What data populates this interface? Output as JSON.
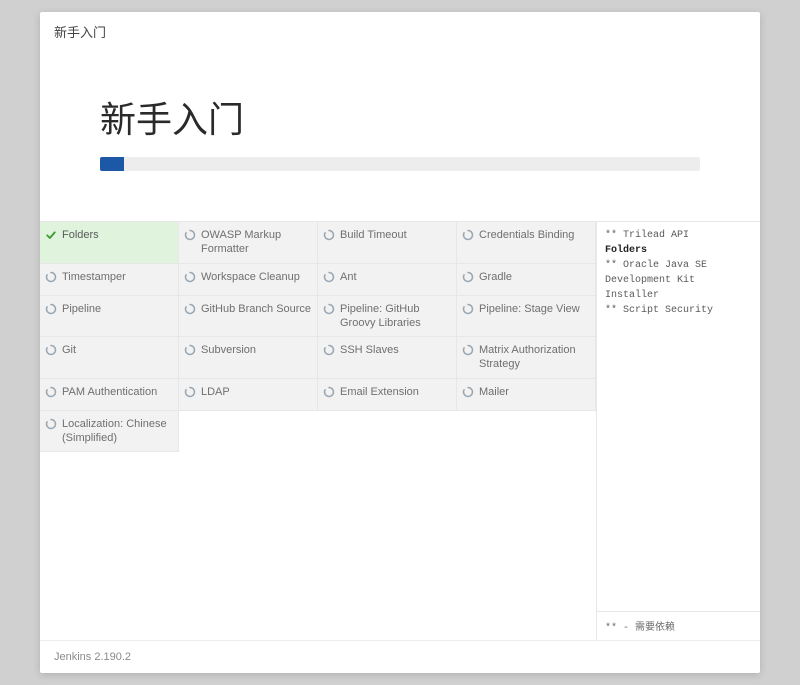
{
  "header": {
    "title": "新手入门"
  },
  "hero": {
    "title": "新手入门",
    "progress_percent": 4
  },
  "plugins": [
    {
      "name": "Folders",
      "state": "success"
    },
    {
      "name": "OWASP Markup Formatter",
      "state": "pending"
    },
    {
      "name": "Build Timeout",
      "state": "pending"
    },
    {
      "name": "Credentials Binding",
      "state": "pending"
    },
    {
      "name": "Timestamper",
      "state": "pending"
    },
    {
      "name": "Workspace Cleanup",
      "state": "pending"
    },
    {
      "name": "Ant",
      "state": "pending"
    },
    {
      "name": "Gradle",
      "state": "pending"
    },
    {
      "name": "Pipeline",
      "state": "pending"
    },
    {
      "name": "GitHub Branch Source",
      "state": "pending"
    },
    {
      "name": "Pipeline: GitHub Groovy Libraries",
      "state": "pending"
    },
    {
      "name": "Pipeline: Stage View",
      "state": "pending"
    },
    {
      "name": "Git",
      "state": "pending"
    },
    {
      "name": "Subversion",
      "state": "pending"
    },
    {
      "name": "SSH Slaves",
      "state": "pending"
    },
    {
      "name": "Matrix Authorization Strategy",
      "state": "pending"
    },
    {
      "name": "PAM Authentication",
      "state": "pending"
    },
    {
      "name": "LDAP",
      "state": "pending"
    },
    {
      "name": "Email Extension",
      "state": "pending"
    },
    {
      "name": "Mailer",
      "state": "pending"
    },
    {
      "name": "Localization: Chinese (Simplified)",
      "state": "pending"
    }
  ],
  "log": {
    "lines": [
      {
        "text": "** Trilead API",
        "bold": false
      },
      {
        "text": "Folders",
        "bold": true
      },
      {
        "text": "** Oracle Java SE Development Kit Installer",
        "bold": false
      },
      {
        "text": "** Script Security",
        "bold": false
      }
    ],
    "footer_note": "** - 需要依赖"
  },
  "footer": {
    "version": "Jenkins 2.190.2"
  },
  "icons": {
    "check_color": "#3f9c35",
    "spinner_color": "#9aa7b2"
  }
}
